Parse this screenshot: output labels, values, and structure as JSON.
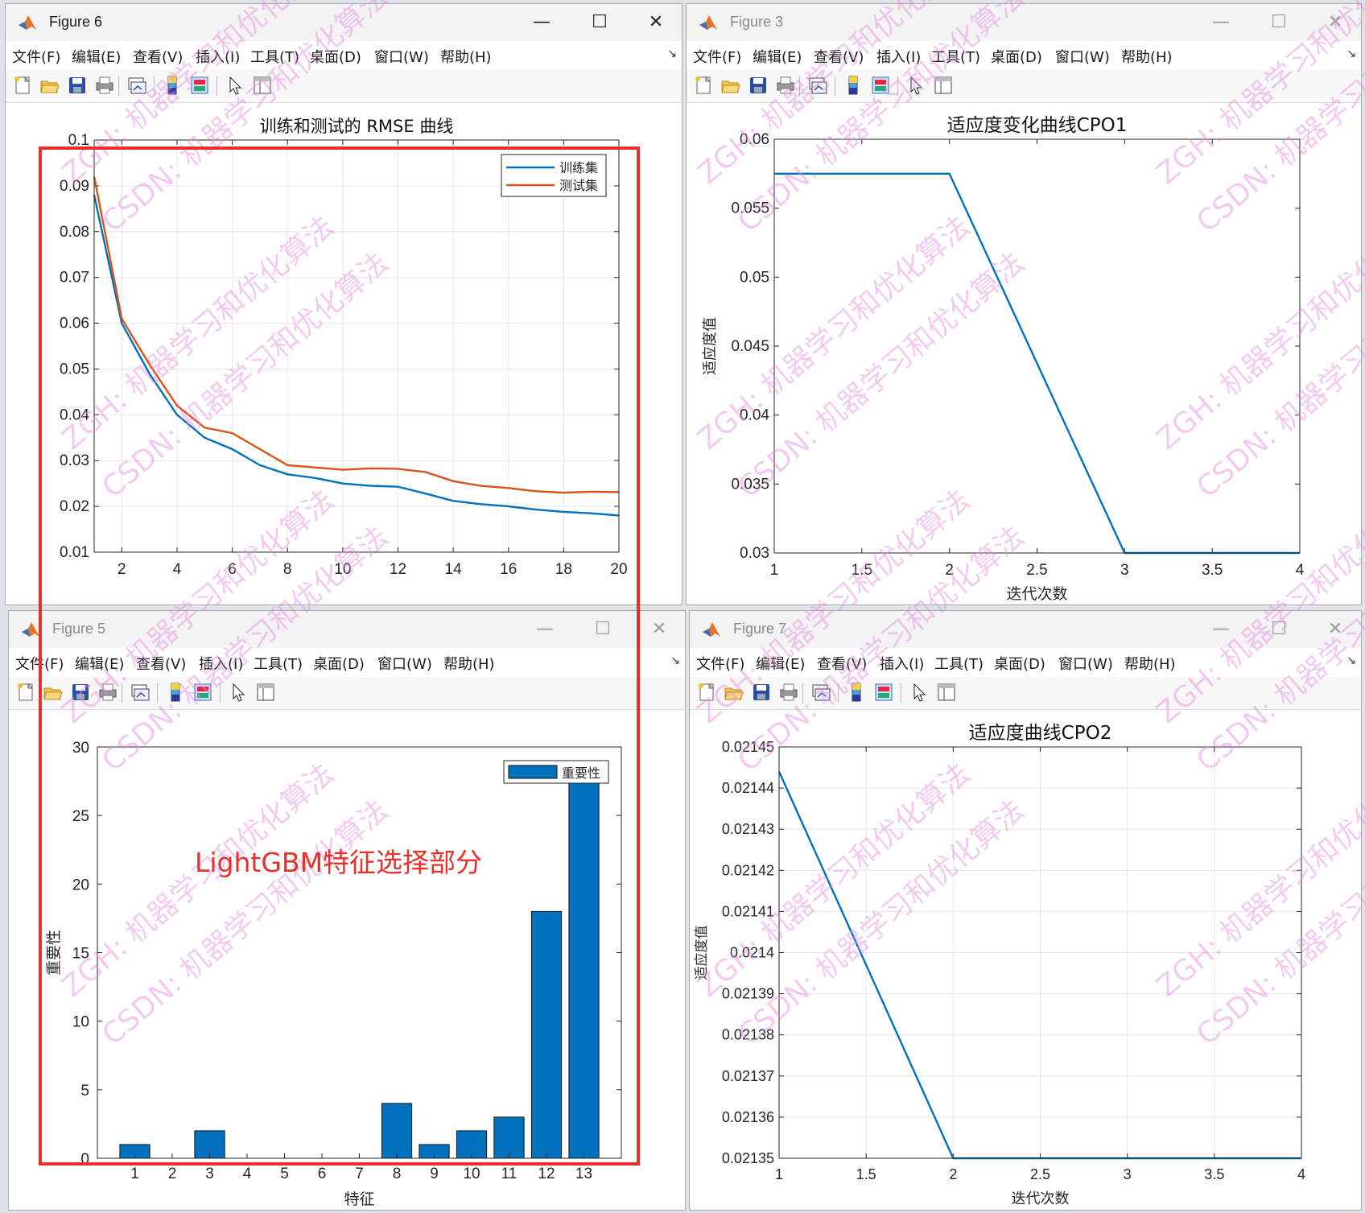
{
  "colors": {
    "line_blue": "#0072BD",
    "line_orange": "#D95319",
    "bar_blue": "#0072BD",
    "highlight_red": "#E8302A",
    "watermark": "#E48BE0"
  },
  "menu_items": [
    "文件(F)",
    "编辑(E)",
    "查看(V)",
    "插入(I)",
    "工具(T)",
    "桌面(D)",
    "窗口(W)",
    "帮助(H)"
  ],
  "toolbar_icons": [
    "new-figure-icon",
    "open-file-icon",
    "save-icon",
    "print-icon",
    "link-plot-icon",
    "insert-colorbar-icon",
    "insert-legend-icon",
    "edit-plot-pointer-icon",
    "property-inspector-icon"
  ],
  "window_controls": {
    "minimize": "—",
    "maximize": "☐",
    "close": "✕"
  },
  "windows": {
    "fig6": {
      "title": "Figure 6"
    },
    "fig3": {
      "title": "Figure 3"
    },
    "fig5": {
      "title": "Figure 5"
    },
    "fig7": {
      "title": "Figure 7"
    }
  },
  "annotation": {
    "text": "LightGBM特征选择部分"
  },
  "watermark": {
    "lines": [
      "ZGH: 机器学习和优化算法",
      "CSDN: 机器学习和优化算法"
    ]
  },
  "chart_data": [
    {
      "id": "rmse",
      "type": "line",
      "title": "训练和测试的 RMSE 曲线",
      "xlabel": "",
      "ylabel": "",
      "xlim": [
        1,
        20
      ],
      "ylim": [
        0.01,
        0.1
      ],
      "xticks": [
        2,
        4,
        6,
        8,
        10,
        12,
        14,
        16,
        18,
        20
      ],
      "yticks": [
        0.01,
        0.02,
        0.03,
        0.04,
        0.05,
        0.06,
        0.07,
        0.08,
        0.09,
        0.1
      ],
      "ytick_labels": [
        "0.01",
        "0.02",
        "0.03",
        "0.04",
        "0.05",
        "0.06",
        "0.07",
        "0.08",
        "0.09",
        "0.1"
      ],
      "grid": true,
      "legend_position": "top-right",
      "x": [
        1,
        2,
        3,
        4,
        5,
        6,
        7,
        8,
        9,
        10,
        11,
        12,
        13,
        14,
        15,
        16,
        17,
        18,
        19,
        20
      ],
      "series": [
        {
          "name": "训练集",
          "color": "#0072BD",
          "values": [
            0.088,
            0.06,
            0.049,
            0.04,
            0.035,
            0.0325,
            0.029,
            0.027,
            0.0262,
            0.025,
            0.0245,
            0.0243,
            0.0228,
            0.0212,
            0.0205,
            0.02,
            0.0193,
            0.0188,
            0.0185,
            0.018
          ]
        },
        {
          "name": "测试集",
          "color": "#D95319",
          "values": [
            0.092,
            0.061,
            0.051,
            0.042,
            0.0372,
            0.036,
            0.0325,
            0.029,
            0.0285,
            0.028,
            0.0283,
            0.0282,
            0.0275,
            0.0255,
            0.0245,
            0.024,
            0.0233,
            0.023,
            0.0232,
            0.0231
          ]
        }
      ]
    },
    {
      "id": "cpo1",
      "type": "line",
      "title": "适应度变化曲线CPO1",
      "xlabel": "迭代次数",
      "ylabel": "适应度值",
      "xlim": [
        1,
        4
      ],
      "ylim": [
        0.03,
        0.06
      ],
      "xticks": [
        1,
        1.5,
        2,
        2.5,
        3,
        3.5,
        4
      ],
      "yticks": [
        0.03,
        0.035,
        0.04,
        0.045,
        0.05,
        0.055,
        0.06
      ],
      "ytick_labels": [
        "0.03",
        "0.035",
        "0.04",
        "0.045",
        "0.05",
        "0.055",
        "0.06"
      ],
      "grid": false,
      "x": [
        1,
        2,
        3,
        4
      ],
      "series": [
        {
          "color": "#0072BD",
          "values": [
            0.0575,
            0.0575,
            0.03,
            0.03
          ]
        }
      ]
    },
    {
      "id": "importance",
      "type": "bar",
      "title": "",
      "xlabel": "特征",
      "ylabel": "重要性",
      "ylim": [
        0,
        30
      ],
      "categories": [
        "1",
        "2",
        "3",
        "4",
        "5",
        "6",
        "7",
        "8",
        "9",
        "10",
        "11",
        "12",
        "13"
      ],
      "yticks": [
        0,
        5,
        10,
        15,
        20,
        25,
        30
      ],
      "ytick_labels": [
        "0",
        "5",
        "10",
        "15",
        "20",
        "25",
        "30"
      ],
      "grid": false,
      "legend_position": "top-right",
      "series": [
        {
          "name": "重要性",
          "color": "#0072BD",
          "values": [
            1,
            0,
            2,
            0,
            0,
            0,
            0,
            4,
            1,
            2,
            3,
            18,
            28
          ]
        }
      ]
    },
    {
      "id": "cpo2",
      "type": "line",
      "title": "适应度曲线CPO2",
      "xlabel": "迭代次数",
      "ylabel": "适应度值",
      "xlim": [
        1,
        4
      ],
      "ylim": [
        0.02135,
        0.02145
      ],
      "xticks": [
        1,
        1.5,
        2,
        2.5,
        3,
        3.5,
        4
      ],
      "yticks": [
        0.02135,
        0.02136,
        0.02137,
        0.02138,
        0.02139,
        0.0214,
        0.02141,
        0.02142,
        0.02143,
        0.02144,
        0.02145
      ],
      "ytick_labels": [
        "0.02135",
        "0.02136",
        "0.02137",
        "0.02138",
        "0.02139",
        "0.0214",
        "0.02141",
        "0.02142",
        "0.02143",
        "0.02144",
        "0.02145"
      ],
      "grid": true,
      "x": [
        1,
        2,
        3,
        4
      ],
      "series": [
        {
          "color": "#0072BD",
          "values": [
            0.021444,
            0.02135,
            0.02135,
            0.02135
          ]
        }
      ]
    }
  ]
}
